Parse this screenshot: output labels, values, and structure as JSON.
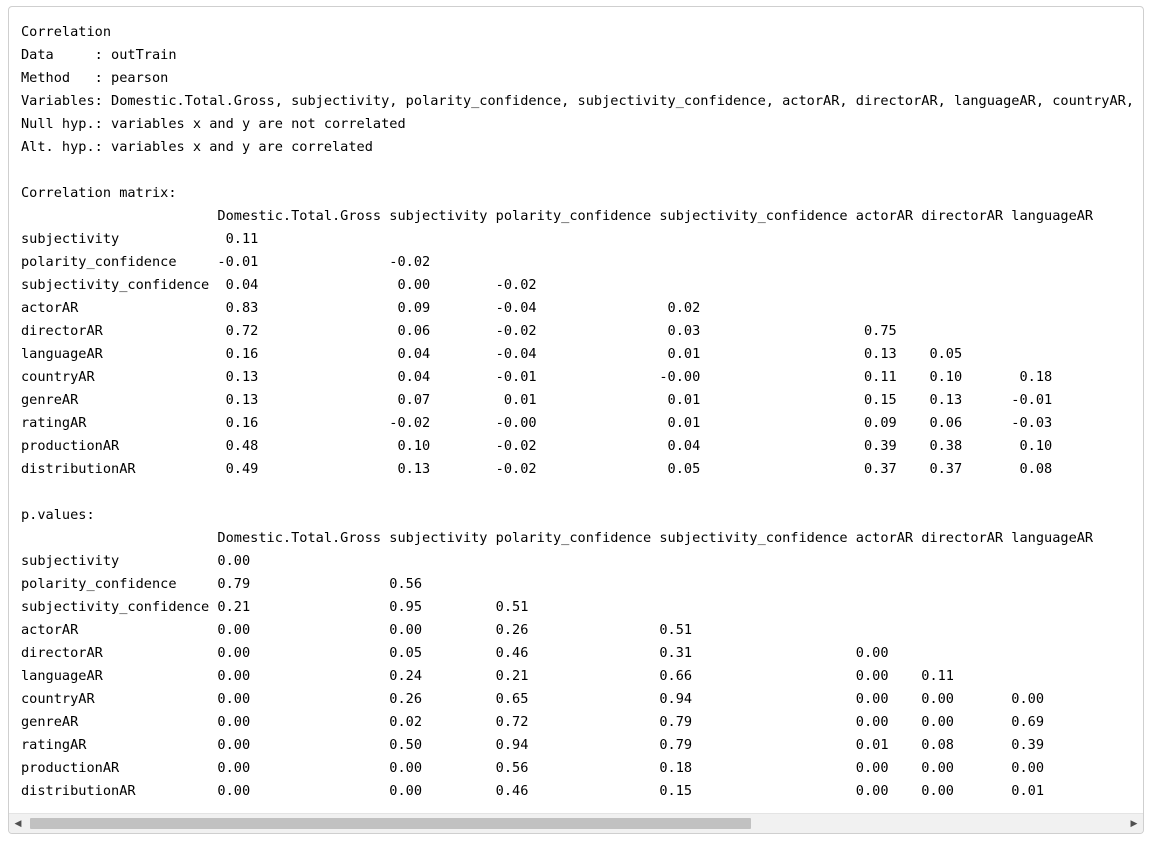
{
  "console_lines": [
    "Correlation",
    "Data     : outTrain",
    "Method   : pearson",
    "Variables: Domestic.Total.Gross, subjectivity, polarity_confidence, subjectivity_confidence, actorAR, directorAR, languageAR, countryAR, genreAR, ratingAR, productionAR, distributionAR",
    "Null hyp.: variables x and y are not correlated",
    "Alt. hyp.: variables x and y are correlated",
    "",
    "Correlation matrix:",
    "                        Domestic.Total.Gross subjectivity polarity_confidence subjectivity_confidence actorAR directorAR languageAR",
    "subjectivity             0.11",
    "polarity_confidence     -0.01                -0.02",
    "subjectivity_confidence  0.04                 0.00        -0.02",
    "actorAR                  0.83                 0.09        -0.04                0.02",
    "directorAR               0.72                 0.06        -0.02                0.03                    0.75",
    "languageAR               0.16                 0.04        -0.04                0.01                    0.13    0.05",
    "countryAR                0.13                 0.04        -0.01               -0.00                    0.11    0.10       0.18",
    "genreAR                  0.13                 0.07         0.01                0.01                    0.15    0.13      -0.01",
    "ratingAR                 0.16                -0.02        -0.00                0.01                    0.09    0.06      -0.03",
    "productionAR             0.48                 0.10        -0.02                0.04                    0.39    0.38       0.10",
    "distributionAR           0.49                 0.13        -0.02                0.05                    0.37    0.37       0.08",
    "",
    "p.values:",
    "                        Domestic.Total.Gross subjectivity polarity_confidence subjectivity_confidence actorAR directorAR languageAR",
    "subjectivity            0.00",
    "polarity_confidence     0.79                 0.56",
    "subjectivity_confidence 0.21                 0.95         0.51",
    "actorAR                 0.00                 0.00         0.26                0.51",
    "directorAR              0.00                 0.05         0.46                0.31                    0.00",
    "languageAR              0.00                 0.24         0.21                0.66                    0.00    0.11",
    "countryAR               0.00                 0.26         0.65                0.94                    0.00    0.00       0.00",
    "genreAR                 0.00                 0.02         0.72                0.79                    0.00    0.00       0.69",
    "ratingAR                0.00                 0.50         0.94                0.79                    0.01    0.08       0.39",
    "productionAR            0.00                 0.00         0.56                0.18                    0.00    0.00       0.00",
    "distributionAR          0.00                 0.00         0.46                0.15                    0.00    0.00       0.01"
  ],
  "scrollbar": {
    "left_arrow": "◀",
    "right_arrow": "▶",
    "thumb_fraction": 0.66
  }
}
